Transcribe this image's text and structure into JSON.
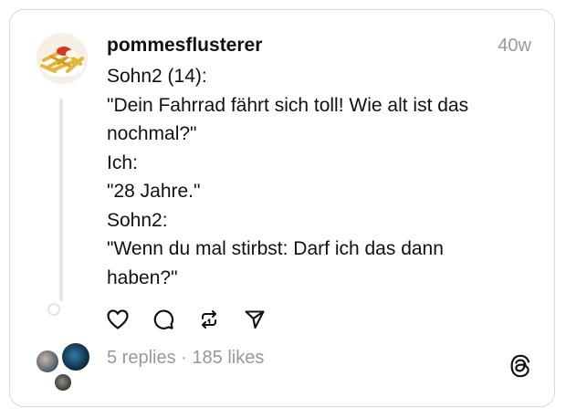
{
  "post": {
    "username": "pommesflusterer",
    "time": "40w",
    "lines": [
      "Sohn2 (14):",
      "\"Dein Fahrrad fährt sich toll! Wie alt ist das",
      "nochmal?\"",
      "Ich:",
      "\"28 Jahre.\"",
      "Sohn2:",
      "\"Wenn du mal stirbst: Darf ich das dann",
      "haben?\""
    ]
  },
  "actions": {
    "like_icon": "heart-icon",
    "reply_icon": "comment-icon",
    "repost_icon": "repost-icon",
    "share_icon": "send-icon"
  },
  "footer": {
    "replies": "5 replies",
    "separator": "·",
    "likes": "185 likes",
    "logo_icon": "threads-logo-icon"
  }
}
